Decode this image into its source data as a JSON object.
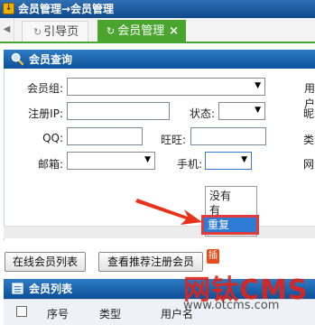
{
  "window": {
    "title": "会员管理→会员管理",
    "title_icon": "download-icon"
  },
  "tabs": {
    "guide_label": "引导页",
    "active_label": "会员管理",
    "close_glyph": "×"
  },
  "search_panel": {
    "title": "会员查询",
    "fields": {
      "member_group_label": "会员组:",
      "user_label_partial": "用户",
      "reg_ip_label": "注册IP:",
      "status_label": "状态:",
      "nick_label_partial": "昵",
      "qq_label": "QQ:",
      "wangwang_label": "旺旺:",
      "type_label_partial": "类",
      "email_label": "邮箱:",
      "phone_label": "手机:",
      "web_label_partial": "网"
    },
    "phone_dropdown": {
      "options": [
        "没有",
        "有",
        "重复"
      ],
      "highlighted": "重复"
    }
  },
  "buttons": {
    "online_list": "在线会员列表",
    "view_referrals": "查看推荐注册会员",
    "badge": "插"
  },
  "list_panel": {
    "title": "会员列表",
    "columns": [
      "序号",
      "类型",
      "用户名"
    ]
  },
  "watermark": {
    "brand": "网钛CMS",
    "url": "www.otcms.com"
  },
  "colors": {
    "accent_green": "#4aa52e",
    "header_blue": "#0b4f97",
    "highlight_red": "#e23b3b"
  }
}
